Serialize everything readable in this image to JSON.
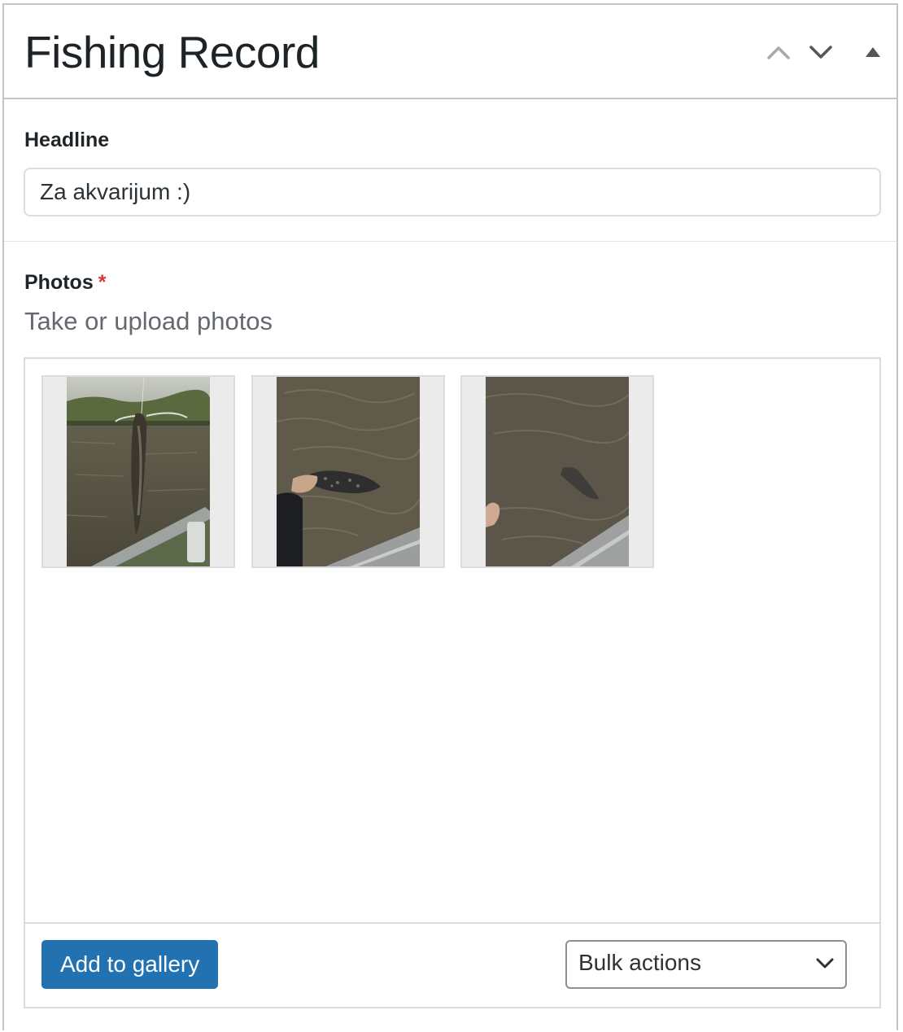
{
  "panel": {
    "title": "Fishing Record",
    "controls": {
      "move_up_icon": "chevron-up-icon",
      "move_down_icon": "chevron-down-icon",
      "toggle_icon": "triangle-up-icon"
    }
  },
  "headline": {
    "label": "Headline",
    "value": "Za akvarijum :)"
  },
  "photos": {
    "label": "Photos",
    "required_marker": "*",
    "description": "Take or upload photos",
    "items": [
      {
        "name": "photo-thumbnail-1"
      },
      {
        "name": "photo-thumbnail-2"
      },
      {
        "name": "photo-thumbnail-3"
      }
    ],
    "add_button_label": "Add to gallery",
    "bulk_actions": {
      "selected": "Bulk actions"
    }
  },
  "colors": {
    "accent": "#2271b1",
    "required": "#d63638",
    "border": "#c3c4c7"
  }
}
